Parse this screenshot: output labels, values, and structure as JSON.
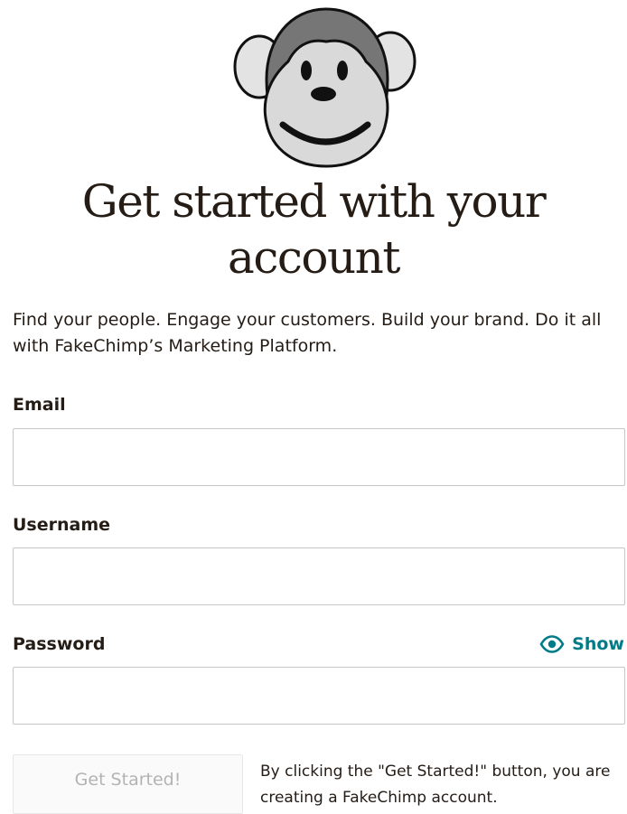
{
  "logo": {
    "icon": "monkey-face-logo",
    "colors": {
      "fur": "#767676",
      "face": "#d9d9d9",
      "outline": "#111111",
      "ears": "#e3e3e3"
    }
  },
  "header": {
    "title": "Get started with your account"
  },
  "intro": {
    "text": "Find your people. Engage your customers. Build your brand. Do it all with FakeChimp’s Marketing Platform."
  },
  "form": {
    "email": {
      "label": "Email",
      "value": "",
      "placeholder": ""
    },
    "username": {
      "label": "Username",
      "value": "",
      "placeholder": ""
    },
    "password": {
      "label": "Password",
      "value": "",
      "placeholder": "",
      "show_label": "Show",
      "show_icon": "eye-icon"
    },
    "submit_label": "Get Started!",
    "terms_text": "By clicking the \"Get Started!\" button, you are creating a FakeChimp account."
  },
  "colors": {
    "accent": "#007c89",
    "text": "#241c15",
    "border": "#c6c6c6",
    "disabled_text": "#b3b3b3"
  }
}
